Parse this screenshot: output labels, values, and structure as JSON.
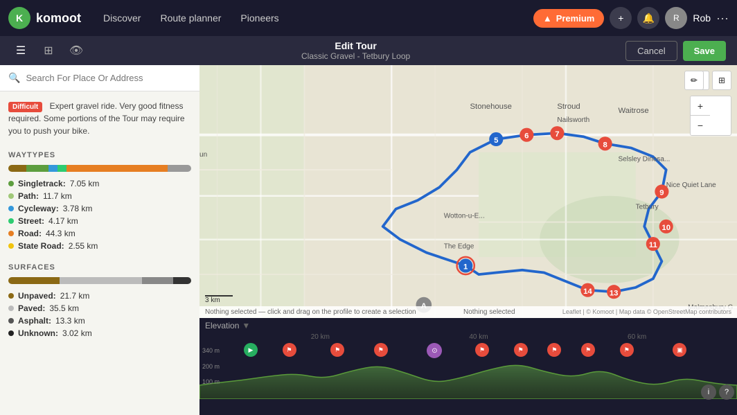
{
  "nav": {
    "logo": "K",
    "app_name": "komoot",
    "links": [
      "Discover",
      "Route planner",
      "Pioneers"
    ],
    "premium_label": "Premium",
    "user": "Rob"
  },
  "subtitle": {
    "edit_title": "Edit Tour",
    "tour_name": "Classic Gravel - Tetbury Loop",
    "cancel_label": "Cancel",
    "save_label": "Save"
  },
  "search": {
    "placeholder": "Search For Place Or Address"
  },
  "difficulty": {
    "badge": "Difficult",
    "description": "Expert gravel ride. Very good fitness required. Some portions of the Tour may require you to push your bike."
  },
  "waytypes": {
    "title": "WAYTYPES",
    "bars": [
      {
        "color": "#8B6914",
        "pct": 10
      },
      {
        "color": "#5d9e3f",
        "pct": 12
      },
      {
        "color": "#3498db",
        "pct": 5
      },
      {
        "color": "#2ecc71",
        "pct": 5
      },
      {
        "color": "#e67e22",
        "pct": 55
      },
      {
        "color": "#999",
        "pct": 13
      }
    ],
    "items": [
      {
        "color": "#5d9e3f",
        "label": "Singletrack:",
        "value": "7.05 km"
      },
      {
        "color": "#a0c878",
        "label": "Path:",
        "value": "11.7 km"
      },
      {
        "color": "#3498db",
        "label": "Cycleway:",
        "value": "3.78 km"
      },
      {
        "color": "#2ecc71",
        "label": "Street:",
        "value": "4.17 km"
      },
      {
        "color": "#e67e22",
        "label": "Road:",
        "value": "44.3 km"
      },
      {
        "color": "#f1c40f",
        "label": "State Road:",
        "value": "2.55 km"
      }
    ]
  },
  "surfaces": {
    "title": "SURFACES",
    "bars": [
      {
        "color": "#8B6914",
        "pct": 28
      },
      {
        "color": "#999",
        "pct": 45
      },
      {
        "color": "#bbb",
        "pct": 17
      },
      {
        "color": "#333",
        "pct": 10
      }
    ],
    "items": [
      {
        "color": "#8B6914",
        "label": "Unpaved:",
        "value": "21.7 km"
      },
      {
        "color": "#aaa",
        "label": "Paved:",
        "value": "35.5 km"
      },
      {
        "color": "#555",
        "label": "Asphalt:",
        "value": "13.3 km"
      },
      {
        "color": "#222",
        "label": "Unknown:",
        "value": "3.02 km"
      }
    ]
  },
  "map": {
    "zoom_in": "+",
    "zoom_out": "−",
    "scale_label": "3 km",
    "attribution": "Leaflet | © Komoot | Map data © OpenStreetMap contributors",
    "status": "Nothing selected — click and drag on the profile to create a selection",
    "status_right": "Nothing selected"
  },
  "elevation": {
    "title": "Elevation",
    "km_labels": [
      "20 km",
      "40 km",
      "60 km"
    ],
    "y_labels": [
      "340 m",
      "200 m",
      "100 m"
    ],
    "waypoints": [
      {
        "type": "start",
        "left": "2%"
      },
      {
        "type": "red",
        "left": "14%"
      },
      {
        "type": "red",
        "left": "23%"
      },
      {
        "type": "red",
        "left": "31%"
      },
      {
        "type": "red",
        "left": "44%"
      },
      {
        "type": "purple",
        "left": "51%"
      },
      {
        "type": "red",
        "left": "58%"
      },
      {
        "type": "red",
        "left": "65%"
      },
      {
        "type": "red",
        "left": "72%"
      },
      {
        "type": "red",
        "left": "80%"
      },
      {
        "type": "red",
        "left": "87%"
      },
      {
        "type": "end",
        "left": "96%"
      }
    ]
  }
}
